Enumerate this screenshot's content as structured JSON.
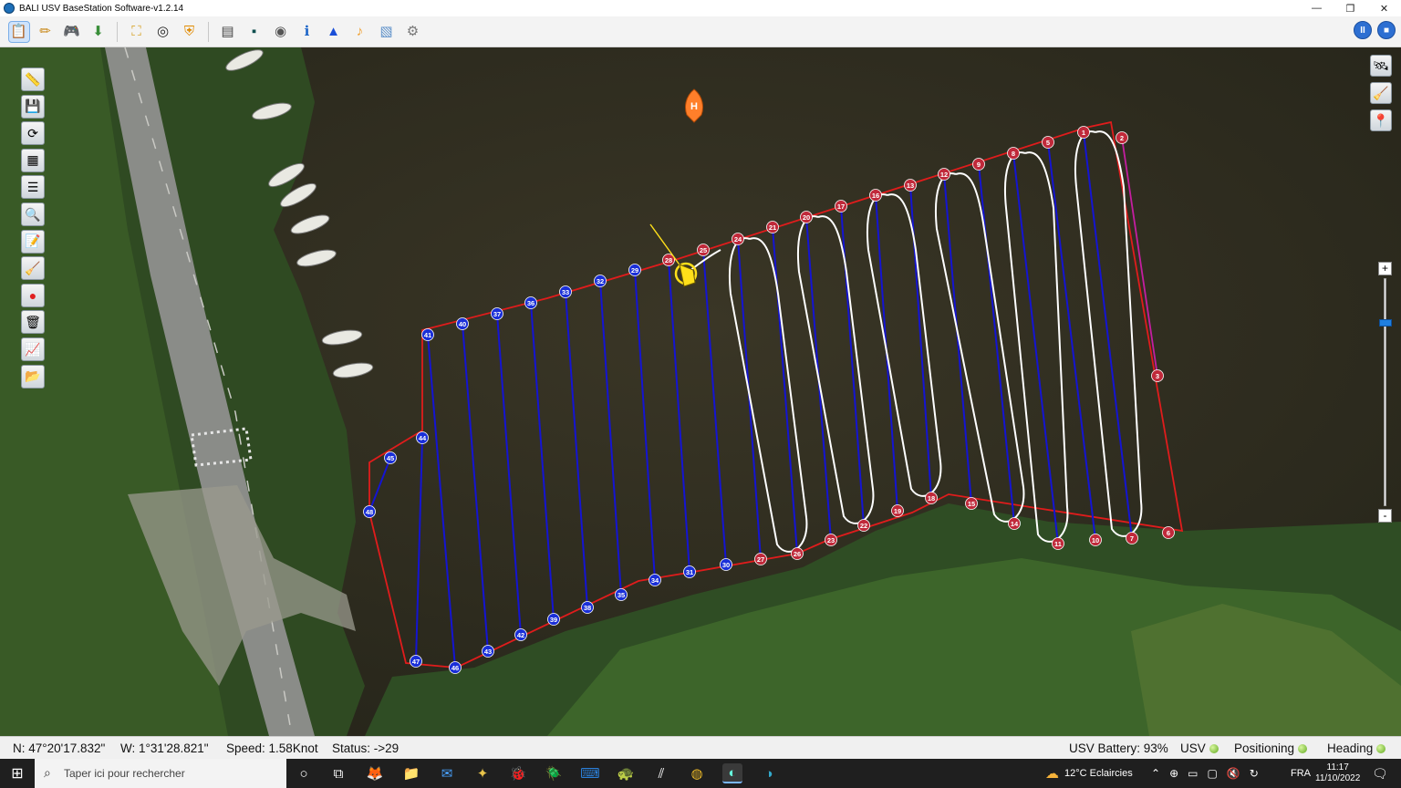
{
  "window": {
    "title": "BALI USV BaseStation Software-v1.2.14",
    "min": "—",
    "restore": "❐",
    "close": "✕"
  },
  "toolbar": {
    "buttons": [
      {
        "name": "new-mission-icon",
        "glyph": "📋"
      },
      {
        "name": "edit-path-icon",
        "glyph": "✏"
      },
      {
        "name": "gamepad-icon",
        "glyph": "🎮"
      },
      {
        "name": "download-icon",
        "glyph": "⬇"
      },
      {
        "name": "fit-view-icon",
        "glyph": "⛶"
      },
      {
        "name": "target-icon",
        "glyph": "◎"
      },
      {
        "name": "shield-icon",
        "glyph": "⛨"
      },
      {
        "name": "log-icon",
        "glyph": "▤"
      },
      {
        "name": "terminal-icon",
        "glyph": "▪"
      },
      {
        "name": "camera-icon",
        "glyph": "◉"
      },
      {
        "name": "info-icon",
        "glyph": "ℹ"
      },
      {
        "name": "navigation-icon",
        "glyph": "▲"
      },
      {
        "name": "sound-icon",
        "glyph": "♪"
      },
      {
        "name": "map-layer-icon",
        "glyph": "▧"
      },
      {
        "name": "settings-icon",
        "glyph": "⚙"
      }
    ],
    "pause_label": "II",
    "stop_label": "■"
  },
  "sidebar": {
    "buttons": [
      {
        "name": "ruler-icon",
        "glyph": "📏"
      },
      {
        "name": "save-icon",
        "glyph": "💾"
      },
      {
        "name": "refresh-icon",
        "glyph": "⟳"
      },
      {
        "name": "grid-icon",
        "glyph": "▦"
      },
      {
        "name": "list-icon",
        "glyph": "☰"
      },
      {
        "name": "zoom-icon",
        "glyph": "🔍"
      },
      {
        "name": "notes-icon",
        "glyph": "📝"
      },
      {
        "name": "clean-icon",
        "glyph": "🧹"
      },
      {
        "name": "record-icon",
        "glyph": "●"
      },
      {
        "name": "trash-icon",
        "glyph": "🗑"
      },
      {
        "name": "chart-icon",
        "glyph": "📈"
      },
      {
        "name": "folder-icon",
        "glyph": "📂"
      }
    ],
    "right_buttons": [
      {
        "name": "satellite-icon",
        "glyph": "🛰"
      },
      {
        "name": "broom-icon",
        "glyph": "🧹"
      },
      {
        "name": "pin-icon",
        "glyph": "📍"
      }
    ]
  },
  "map": {
    "home_label": "H",
    "zoom_in": "+",
    "zoom_out": "-",
    "zoom_level": 0.82,
    "colors": {
      "boundary": "#e01c1c",
      "planned": "#1414d2",
      "track": "#ffffff",
      "done_marker": "#c0293a",
      "todo_marker": "#1a2fd8",
      "vessel": "#ffe01a",
      "home": "#ff7f2a"
    },
    "waypoints": [
      {
        "n": "1"
      },
      {
        "n": "2"
      },
      {
        "n": "3"
      },
      {
        "n": "5"
      },
      {
        "n": "6"
      },
      {
        "n": "7"
      },
      {
        "n": "8"
      },
      {
        "n": "9"
      },
      {
        "n": "10"
      },
      {
        "n": "11"
      },
      {
        "n": "12"
      },
      {
        "n": "13"
      },
      {
        "n": "14"
      },
      {
        "n": "15"
      },
      {
        "n": "16"
      },
      {
        "n": "17"
      },
      {
        "n": "18"
      },
      {
        "n": "19"
      },
      {
        "n": "20"
      },
      {
        "n": "21"
      },
      {
        "n": "22"
      },
      {
        "n": "23"
      },
      {
        "n": "24"
      },
      {
        "n": "25"
      },
      {
        "n": "26"
      },
      {
        "n": "27"
      },
      {
        "n": "28"
      },
      {
        "n": "29"
      },
      {
        "n": "30"
      },
      {
        "n": "31"
      },
      {
        "n": "32"
      },
      {
        "n": "33"
      },
      {
        "n": "34"
      },
      {
        "n": "35"
      },
      {
        "n": "36"
      },
      {
        "n": "37"
      },
      {
        "n": "38"
      },
      {
        "n": "39"
      },
      {
        "n": "40"
      },
      {
        "n": "41"
      },
      {
        "n": "42"
      },
      {
        "n": "43"
      },
      {
        "n": "44"
      },
      {
        "n": "45"
      },
      {
        "n": "46"
      },
      {
        "n": "47"
      },
      {
        "n": "48"
      }
    ]
  },
  "status": {
    "lat": "N: 47°20'17.832\"",
    "lon": "W:  1°31'28.821\"",
    "speed": "Speed: 1.58Knot",
    "state": "Status: ->29",
    "battery": "USV Battery: 93%",
    "usv": "USV",
    "positioning": "Positioning",
    "heading": "Heading"
  },
  "taskbar": {
    "search_placeholder": "Taper ici pour rechercher",
    "weather": "12°C  Eclaircies",
    "lang": "FRA",
    "time": "11:17",
    "date": "11/10/2022",
    "apps": [
      {
        "name": "cortana-icon",
        "glyph": "○"
      },
      {
        "name": "task-view-icon",
        "glyph": "⧉"
      },
      {
        "name": "firefox-icon",
        "glyph": "🦊"
      },
      {
        "name": "explorer-icon",
        "glyph": "📁"
      },
      {
        "name": "mail-icon",
        "glyph": "✉"
      },
      {
        "name": "tool-icon",
        "glyph": "✦"
      },
      {
        "name": "bug-icon",
        "glyph": "🐞"
      },
      {
        "name": "beetle-icon",
        "glyph": "🪲"
      },
      {
        "name": "vscode-icon",
        "glyph": "⌨"
      },
      {
        "name": "turtle-icon",
        "glyph": "🐢"
      },
      {
        "name": "vpn-icon",
        "glyph": "⫽"
      },
      {
        "name": "chrome-icon",
        "glyph": "◍"
      },
      {
        "name": "basestation-icon",
        "glyph": "◐"
      },
      {
        "name": "edge-icon",
        "glyph": "◑"
      }
    ]
  }
}
